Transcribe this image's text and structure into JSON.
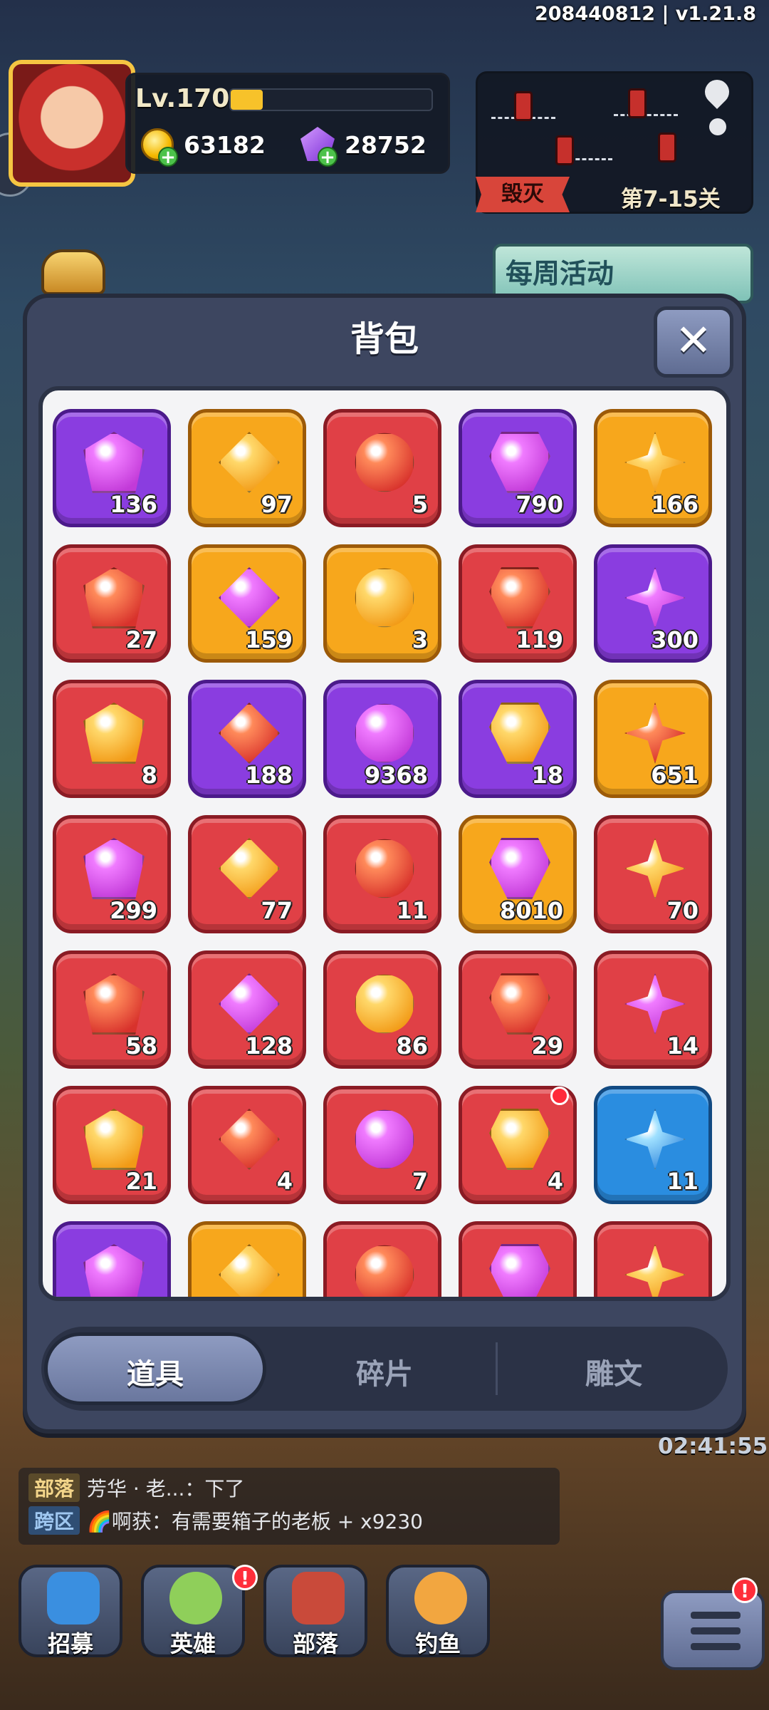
{
  "hud": {
    "version": "208440812 | v1.21.8",
    "level": "Lv.170",
    "xp_fraction": 0.16,
    "coins": "63182",
    "gems": "28752",
    "plus": "+",
    "map_tag": "毁灭",
    "stage": "第7-15关",
    "weekly_event": "每周活动"
  },
  "backpack": {
    "title": "背包",
    "close_symbol": "✕",
    "items": [
      {
        "rarity": "purple",
        "icon": "purple-gem-icon",
        "count": "136"
      },
      {
        "rarity": "orange",
        "icon": "orange-gem-icon",
        "count": "97"
      },
      {
        "rarity": "red",
        "icon": "red-gem-icon",
        "count": "5"
      },
      {
        "rarity": "purple",
        "icon": "purple-seal-icon",
        "count": "790"
      },
      {
        "rarity": "orange",
        "icon": "orange-seal-icon",
        "count": "166"
      },
      {
        "rarity": "red",
        "icon": "red-seal-icon",
        "count": "27"
      },
      {
        "rarity": "orange",
        "icon": "star-ticket-icon",
        "count": "159"
      },
      {
        "rarity": "orange",
        "icon": "silver-crown-badge-icon",
        "count": "3"
      },
      {
        "rarity": "red",
        "icon": "gold-crown-badge-icon",
        "count": "119"
      },
      {
        "rarity": "purple",
        "icon": "swirl-stone-icon",
        "count": "300"
      },
      {
        "rarity": "red",
        "icon": "red-crystal-shard-icon",
        "count": "8"
      },
      {
        "rarity": "purple",
        "icon": "gold-ticket-icon",
        "count": "188"
      },
      {
        "rarity": "purple",
        "icon": "star-shard-icon",
        "count": "9368"
      },
      {
        "rarity": "purple",
        "icon": "purple-ore-icon",
        "count": "18"
      },
      {
        "rarity": "orange",
        "icon": "orange-ore-icon",
        "count": "651"
      },
      {
        "rarity": "red",
        "icon": "red-ore-icon",
        "count": "299"
      },
      {
        "rarity": "red",
        "icon": "crystal-ore-icon",
        "count": "77"
      },
      {
        "rarity": "red",
        "icon": "sword-gem-icon",
        "count": "11"
      },
      {
        "rarity": "orange",
        "icon": "gold-coin-icon",
        "count": "8010"
      },
      {
        "rarity": "red",
        "icon": "ice-crystal-icon",
        "count": "70"
      },
      {
        "rarity": "red",
        "icon": "green-gem-icon",
        "count": "58"
      },
      {
        "rarity": "red",
        "icon": "amber-egg-icon",
        "count": "128"
      },
      {
        "rarity": "red",
        "icon": "purple-crystal-cluster-icon",
        "count": "86"
      },
      {
        "rarity": "red",
        "icon": "scroll-icon",
        "count": "29"
      },
      {
        "rarity": "red",
        "icon": "fire-crystal-icon",
        "count": "14"
      },
      {
        "rarity": "red",
        "icon": "blue-chest-icon",
        "count": "21"
      },
      {
        "rarity": "red",
        "icon": "pink-paw-chest-icon",
        "count": "4"
      },
      {
        "rarity": "red",
        "icon": "map-fragment-icon",
        "count": "7"
      },
      {
        "rarity": "red",
        "icon": "gold-chest-icon",
        "count": "4",
        "badge": true
      },
      {
        "rarity": "blue",
        "icon": "blue-crystal-icon",
        "count": "11"
      },
      {
        "rarity": "purple",
        "icon": "purple-shard-icon",
        "count": ""
      },
      {
        "rarity": "orange",
        "icon": "gold-shard-icon",
        "count": ""
      },
      {
        "rarity": "red",
        "icon": "ruby-icon",
        "count": ""
      },
      {
        "rarity": "red",
        "icon": "feather-icon",
        "count": ""
      },
      {
        "rarity": "red",
        "icon": "red-rune-icon",
        "count": ""
      }
    ],
    "tabs": [
      "道具",
      "碎片",
      "雕文"
    ],
    "active_tab": 0
  },
  "bottom": {
    "timer": "02:41:55",
    "chat": [
      {
        "tag": "部落",
        "text": "芳华 · 老...：下了"
      },
      {
        "tag": "跨区",
        "text": "🌈啊获：有需要箱子的老板 + x9230"
      }
    ],
    "nav": [
      "招募",
      "英雄",
      "部落",
      "钓鱼"
    ],
    "nav_badge": "!"
  },
  "colors": {
    "red": "#e04046",
    "orange": "#f7a71c",
    "purple": "#8a3de0",
    "blue": "#2a8de0"
  }
}
